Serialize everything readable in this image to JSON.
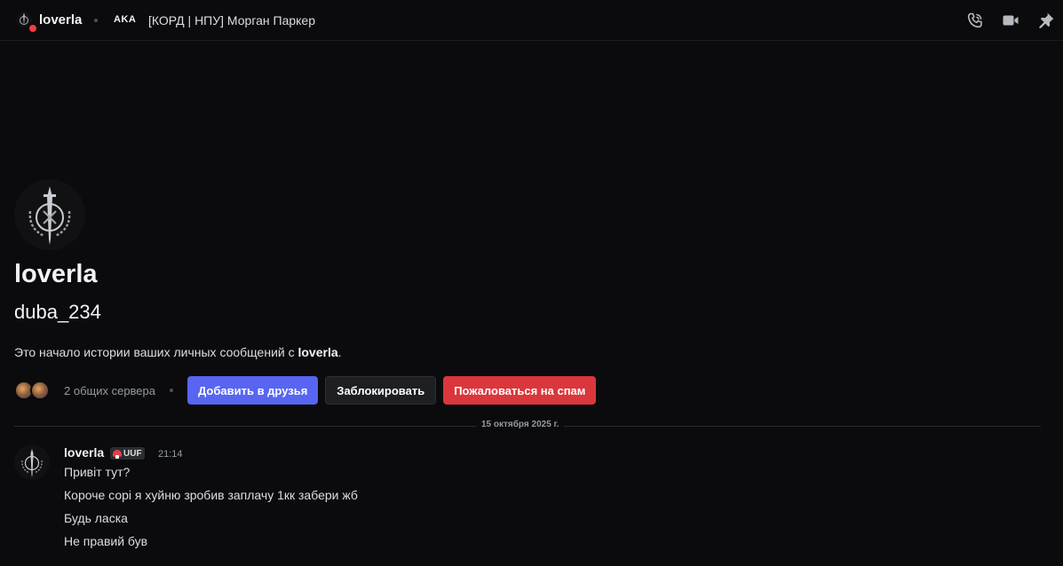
{
  "header": {
    "name": "loverla",
    "aka_label": "AKA",
    "aka_name": "[КОРД | НПУ] Морган Паркер"
  },
  "profile": {
    "display_name": "loverla",
    "username": "duba_234",
    "intro_prefix": "Это начало истории ваших личных сообщений с ",
    "intro_name": "loverla",
    "intro_suffix": ".",
    "mutual_servers": "2 общих сервера",
    "add_friend": "Добавить в друзья",
    "block": "Заблокировать",
    "report_spam": "Пожаловаться на спам"
  },
  "divider_date": "15 октября 2025 г.",
  "message_group": {
    "author": "loverla",
    "tag": "UUF",
    "time": "21:14",
    "lines": [
      "Привіт тут?",
      "Короче сорі я хуйню зробив заплачу 1кк забери жб",
      "Будь ласка",
      "Не правий був"
    ]
  },
  "colors": {
    "background": "#0b0b0d",
    "primary_button": "#5865f2",
    "danger_button": "#da373c",
    "dnd_status": "#f23f43"
  },
  "icons": {
    "voice_call": "phone-icon",
    "video_call": "video-camera-icon",
    "pinned": "pin-icon"
  }
}
